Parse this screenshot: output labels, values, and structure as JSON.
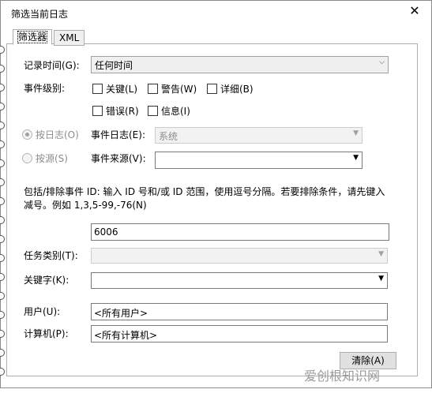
{
  "window": {
    "title": "筛选当前日志",
    "close_glyph": "✕"
  },
  "tabs": [
    {
      "label": "筛选器"
    },
    {
      "label": "XML"
    }
  ],
  "form": {
    "logged_label": "记录时间(G):",
    "logged_value": "任何时间",
    "event_level_label": "事件级别:",
    "levels": [
      {
        "label": "关键(L)"
      },
      {
        "label": "警告(W)"
      },
      {
        "label": "详细(B)"
      },
      {
        "label": "错误(R)"
      },
      {
        "label": "信息(I)"
      }
    ],
    "by_log_label": "按日志(O)",
    "event_log_label": "事件日志(E):",
    "event_log_value": "系统",
    "by_source_label": "按源(S)",
    "event_source_label": "事件来源(V):",
    "help_line1": "包括/排除事件 ID: 输入 ID 号和/或 ID 范围，使用逗号分隔。若要排除条件，请先键入",
    "help_line2": "减号。例如 1,3,5-99,-76(N)",
    "event_id_value": "6006",
    "task_category_label": "任务类别(T):",
    "keywords_label": "关键字(K):",
    "user_label": "用户(U):",
    "user_value": "<所有用户>",
    "computer_label": "计算机(P):",
    "computer_value": "<所有计算机>",
    "clear_button": "清除(A)"
  },
  "watermark": "爱创根知识网"
}
